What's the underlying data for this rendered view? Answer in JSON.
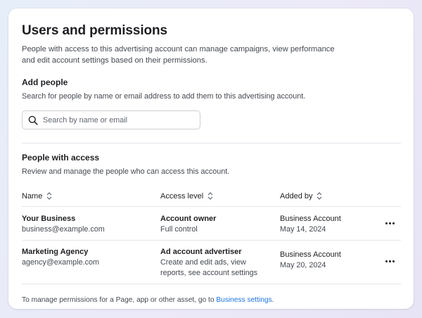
{
  "header": {
    "title": "Users and permissions",
    "description": "People with access to this advertising account can manage campaigns, view performance and edit account settings based on their permissions."
  },
  "add_people": {
    "title": "Add people",
    "subtitle": "Search for people by name or email address to add them to this advertising account.",
    "search": {
      "placeholder": "Search by name or email",
      "value": "",
      "icon": "search-icon"
    }
  },
  "people_access": {
    "title": "People with access",
    "subtitle": "Review and manage the people who can access this account.",
    "columns": [
      {
        "label": "Name",
        "icon": "sort-icon"
      },
      {
        "label": "Access level",
        "icon": "sort-icon"
      },
      {
        "label": "Added by",
        "icon": "sort-icon"
      }
    ],
    "rows": [
      {
        "name": "Your Business",
        "email": "business@example.com",
        "access_level": "Account owner",
        "access_desc": "Full control",
        "added_by": "Business Account",
        "added_date": "May 14, 2024",
        "more_icon": "more-options-icon"
      },
      {
        "name": "Marketing Agency",
        "email": "agency@example.com",
        "access_level": "Ad account advertiser",
        "access_desc": "Create and edit ads, view reports, see account settings",
        "added_by": "Business Account",
        "added_date": "May 20, 2024",
        "more_icon": "more-options-icon"
      }
    ]
  },
  "footer": {
    "text": "To manage permissions for a Page, app or other asset, go to ",
    "link": "Business settings",
    "suffix": "."
  },
  "colors": {
    "link": "#1b74e4",
    "text_primary": "#1c1e21",
    "text_secondary": "#444950",
    "divider": "#e4e6eb"
  }
}
